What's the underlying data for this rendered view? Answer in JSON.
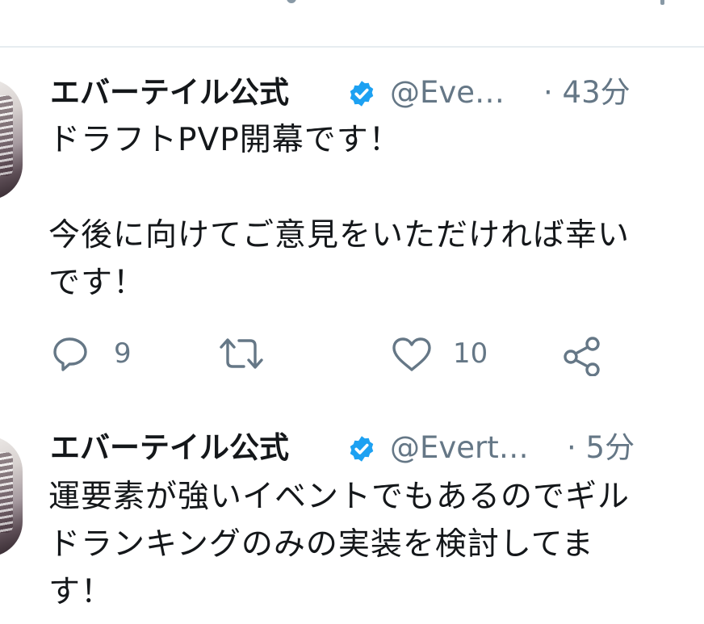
{
  "colors": {
    "text_primary": "#14171a",
    "text_secondary": "#657786",
    "verified_blue": "#1da1f2",
    "divider": "#e6ecf0"
  },
  "tweets": [
    {
      "display_name": "エバーテイル公式",
      "handle": "@Eve…",
      "time": "· 43分",
      "text": "ドラフトPVP開幕です！\n\n今後に向けてご意見をいただければ幸い\nです！",
      "reply_count": "9",
      "retweet_count": "",
      "like_count": "10",
      "icons": [
        "verified-icon",
        "chevron-down-icon",
        "reply-icon",
        "retweet-icon",
        "like-icon",
        "share-icon"
      ]
    },
    {
      "display_name": "エバーテイル公式",
      "handle": "@Evert…",
      "time": "· 5分",
      "text": "運要素が強いイベントでもあるのでギル\nドランキングのみの実装を検討してま\nす！",
      "icons": [
        "verified-icon",
        "chevron-down-icon"
      ]
    }
  ]
}
